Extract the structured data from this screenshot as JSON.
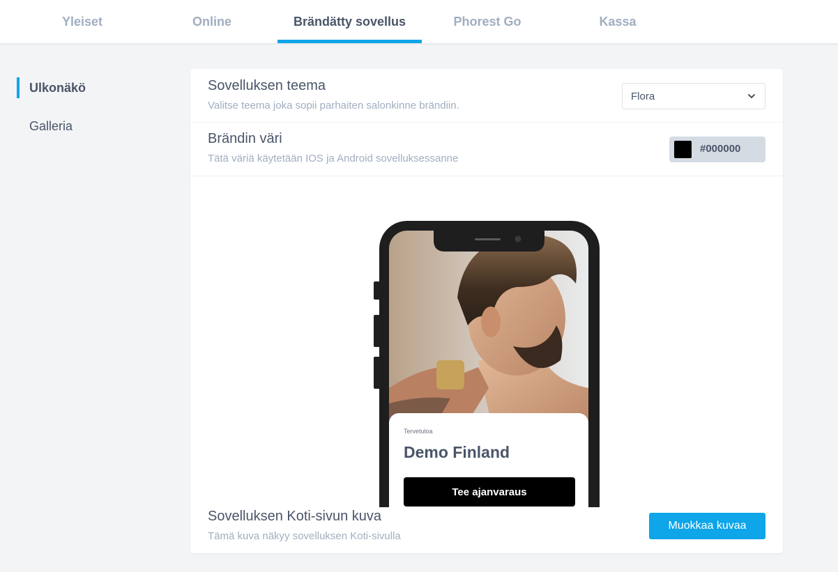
{
  "tabs": [
    {
      "label": "Yleiset",
      "active": false
    },
    {
      "label": "Online",
      "active": false
    },
    {
      "label": "Brändätty sovellus",
      "active": true
    },
    {
      "label": "Phorest Go",
      "active": false
    },
    {
      "label": "Kassa",
      "active": false
    }
  ],
  "sidebar": {
    "items": [
      {
        "label": "Ulkonäkö",
        "active": true
      },
      {
        "label": "Galleria",
        "active": false
      }
    ]
  },
  "theme": {
    "title": "Sovelluksen teema",
    "description": "Valitse teema joka sopii parhaiten salonkinne brändiin.",
    "selected": "Flora"
  },
  "brand_color": {
    "title": "Brändin väri",
    "description": "Tätä väriä käytetään IOS ja Android sovelluksessanne",
    "value": "#000000"
  },
  "preview": {
    "welcome": "Tervetuloa",
    "salon_name": "Demo Finland",
    "cta_label": "Tee ajanvaraus"
  },
  "home_image": {
    "title": "Sovelluksen Koti-sivun kuva",
    "description": "Tämä kuva näkyy sovelluksen Koti-sivulla",
    "button_label": "Muokkaa kuvaa"
  },
  "colors": {
    "accent": "#0ea5e9",
    "text": "#4a5568",
    "muted": "#a0aec0",
    "background": "#f3f4f6"
  }
}
